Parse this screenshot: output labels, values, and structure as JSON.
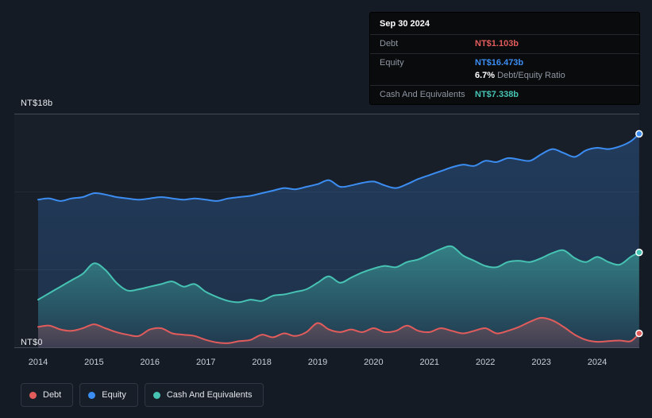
{
  "y_axis": {
    "top_label": "NT$18b",
    "bottom_label": "NT$0"
  },
  "tooltip": {
    "date": "Sep 30 2024",
    "rows": [
      {
        "label": "Debt",
        "value": "NT$1.103b",
        "color": "#e25c5c"
      },
      {
        "label": "Equity",
        "value": "NT$16.473b",
        "color": "#3b8df2",
        "ratio_bold": "6.7%",
        "ratio_text": "Debt/Equity Ratio"
      },
      {
        "label": "Cash And Equivalents",
        "value": "NT$7.338b",
        "color": "#46c3b3"
      }
    ]
  },
  "legend": {
    "items": [
      {
        "label": "Debt",
        "color": "#e25c5c"
      },
      {
        "label": "Equity",
        "color": "#3b8df2"
      },
      {
        "label": "Cash And Equivalents",
        "color": "#46c3b3"
      }
    ]
  },
  "chart_data": {
    "type": "area",
    "x_min": 2014,
    "x_max": 2024.75,
    "x_step": 0.2,
    "x_ticks": [
      2014,
      2015,
      2016,
      2017,
      2018,
      2019,
      2020,
      2021,
      2022,
      2023,
      2024
    ],
    "ylim": [
      0,
      18
    ],
    "y_gridlines": [
      0,
      6,
      12,
      18
    ],
    "y_unit": "NT$b",
    "latest_date": "Sep 30 2024",
    "latest": {
      "debt": 1.103,
      "equity": 16.473,
      "cash_and_equivalents": 7.338,
      "debt_equity_ratio_pct": 6.7
    },
    "series": [
      {
        "name": "Equity",
        "color": "#3b8df2",
        "values": [
          11.4,
          11.5,
          11.3,
          11.5,
          11.6,
          11.9,
          11.8,
          11.6,
          11.5,
          11.4,
          11.5,
          11.6,
          11.5,
          11.4,
          11.5,
          11.4,
          11.3,
          11.5,
          11.6,
          11.7,
          11.9,
          12.1,
          12.3,
          12.2,
          12.4,
          12.6,
          12.9,
          12.4,
          12.5,
          12.7,
          12.8,
          12.5,
          12.3,
          12.6,
          13.0,
          13.3,
          13.6,
          13.9,
          14.1,
          14.0,
          14.4,
          14.3,
          14.6,
          14.5,
          14.4,
          14.9,
          15.3,
          15.0,
          14.7,
          15.2,
          15.4,
          15.3,
          15.5,
          15.9,
          16.473
        ]
      },
      {
        "name": "Cash And Equivalents",
        "color": "#46c3b3",
        "values": [
          3.7,
          4.2,
          4.7,
          5.2,
          5.7,
          6.5,
          6.0,
          5.0,
          4.4,
          4.5,
          4.7,
          4.9,
          5.1,
          4.7,
          4.9,
          4.3,
          3.9,
          3.6,
          3.5,
          3.7,
          3.6,
          4.0,
          4.1,
          4.3,
          4.5,
          5.0,
          5.5,
          5.0,
          5.4,
          5.8,
          6.1,
          6.3,
          6.2,
          6.6,
          6.8,
          7.2,
          7.6,
          7.8,
          7.1,
          6.7,
          6.3,
          6.2,
          6.6,
          6.7,
          6.6,
          6.9,
          7.3,
          7.5,
          6.9,
          6.6,
          7.0,
          6.6,
          6.4,
          7.0,
          7.338
        ]
      },
      {
        "name": "Debt",
        "color": "#e25c5c",
        "values": [
          1.6,
          1.7,
          1.4,
          1.3,
          1.5,
          1.8,
          1.5,
          1.2,
          1.0,
          0.9,
          1.4,
          1.5,
          1.1,
          1.0,
          0.9,
          0.6,
          0.4,
          0.35,
          0.5,
          0.6,
          1.0,
          0.8,
          1.1,
          0.9,
          1.2,
          1.9,
          1.4,
          1.2,
          1.4,
          1.2,
          1.5,
          1.2,
          1.3,
          1.7,
          1.3,
          1.2,
          1.5,
          1.3,
          1.1,
          1.3,
          1.5,
          1.1,
          1.3,
          1.6,
          2.0,
          2.3,
          2.1,
          1.6,
          1.0,
          0.6,
          0.45,
          0.5,
          0.55,
          0.5,
          1.103
        ]
      }
    ]
  }
}
